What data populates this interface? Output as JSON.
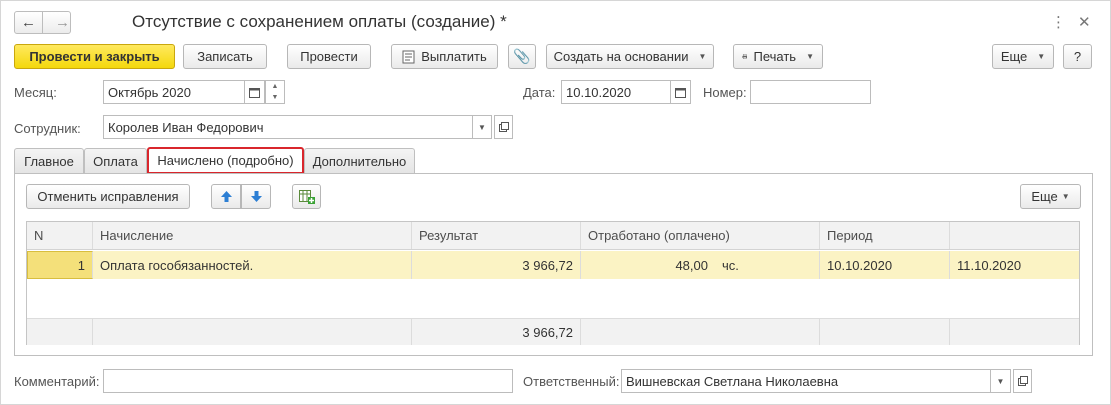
{
  "window": {
    "title": "Отсутствие с сохранением оплаты (создание) *",
    "nav_back": "←",
    "nav_forward": "→",
    "menu_icon": "⋮",
    "close_icon": "✕"
  },
  "toolbar": {
    "post_close": "Провести и закрыть",
    "save": "Записать",
    "post": "Провести",
    "pay": "Выплатить",
    "create_based": "Создать на основании",
    "print": "Печать",
    "more": "Еще",
    "help": "?"
  },
  "form": {
    "month_label": "Месяц:",
    "month_value": "Октябрь 2020",
    "date_label": "Дата:",
    "date_value": "10.10.2020",
    "number_label": "Номер:",
    "number_value": "",
    "employee_label": "Сотрудник:",
    "employee_value": "Королев Иван Федорович",
    "comment_label": "Комментарий:",
    "comment_value": "",
    "responsible_label": "Ответственный:",
    "responsible_value": "Вишневская Светлана Николаевна"
  },
  "tabs": [
    {
      "label": "Главное"
    },
    {
      "label": "Оплата"
    },
    {
      "label": "Начислено (подробно)"
    },
    {
      "label": "Дополнительно"
    }
  ],
  "panel": {
    "cancel_corrections": "Отменить исправления",
    "more": "Еще"
  },
  "table": {
    "headers": [
      "N",
      "Начисление",
      "Результат",
      "Отработано (оплачено)",
      "Период",
      ""
    ],
    "rows": [
      {
        "n": "1",
        "accrual": "Оплата гособязанностей.",
        "result": "3 966,72",
        "worked": "48,00",
        "unit": "чс.",
        "period_from": "10.10.2020",
        "period_to": "11.10.2020"
      }
    ],
    "total_result": "3 966,72"
  },
  "colors": {
    "primary": "#f4d80c",
    "active_tab_border": "#d9262c",
    "selected_row": "#fbf3c4"
  }
}
